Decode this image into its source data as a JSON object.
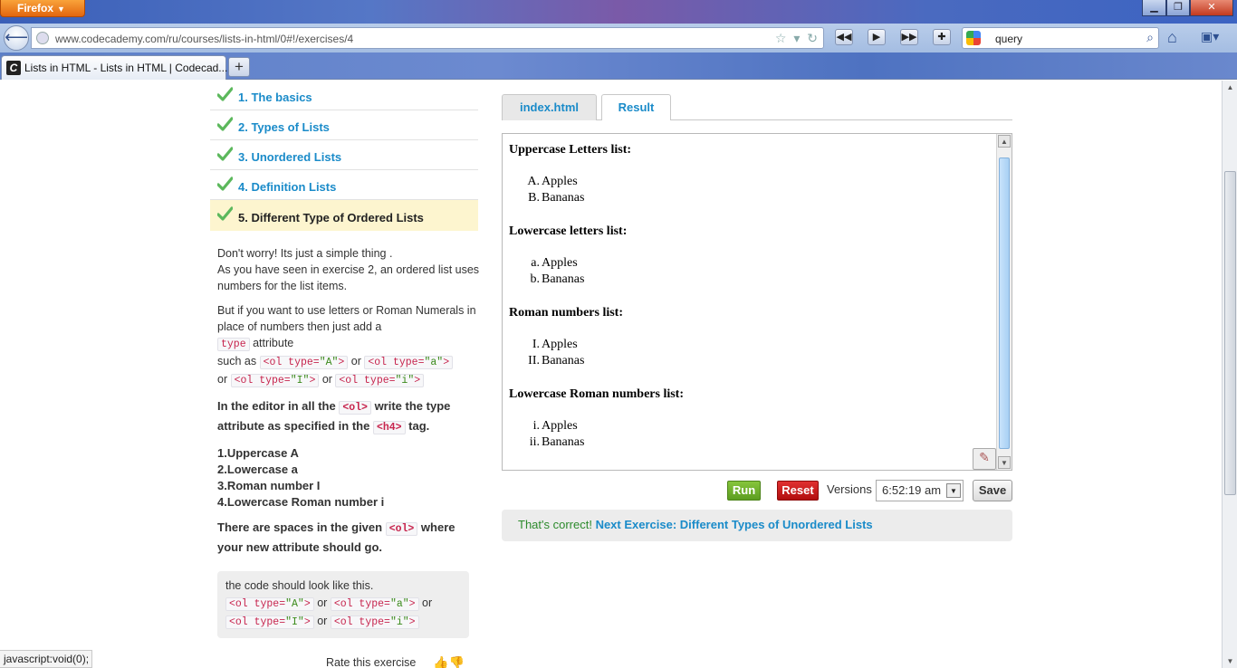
{
  "browser": {
    "app_button": "Firefox",
    "url": "www.codecademy.com/ru/courses/lists-in-html/0#!/exercises/4",
    "search_query": "query",
    "tab_title": "Lists in HTML - Lists in HTML | Codecad...",
    "status_text": "javascript:void(0);"
  },
  "exercises": [
    {
      "label": "1. The basics"
    },
    {
      "label": "2. Types of Lists"
    },
    {
      "label": "3. Unordered Lists"
    },
    {
      "label": "4. Definition Lists"
    },
    {
      "label": "5. Different Type of Ordered Lists"
    }
  ],
  "instructions": {
    "p1_line1": "Don't worry! Its just a simple thing .",
    "p1_line2": "As you have seen in exercise 2, an ordered list uses numbers for the list items.",
    "p2_text": "But if you want to use letters or Roman Numerals in place of numbers then just add a",
    "p2_code": "type",
    "p2_after": " attribute",
    "such_as": "such as ",
    "or": " or ",
    "code_A_open": "<ol type=",
    "code_A_val": "\"A\"",
    "code_a_val": "\"a\"",
    "code_I_val": "\"I\"",
    "code_i_val": "\"i\"",
    "code_close": ">",
    "p3_a": "In the editor in all the ",
    "p3_code1": "<ol>",
    "p3_b": " write the type attribute as specified in the ",
    "p3_code2": "<h4>",
    "p3_c": " tag.",
    "steps": [
      "1.Uppercase A",
      "2.Lowercase a",
      "3.Roman number I",
      "4.Lowercase Roman number i"
    ],
    "p4_a": "There are spaces in the given ",
    "p4_code": "<ol>",
    "p4_b": " where your new attribute should go."
  },
  "hint": {
    "text": "the code should look like this."
  },
  "rate_label": "Rate this exercise",
  "editor_tabs": {
    "file": "index.html",
    "result": "Result"
  },
  "result": {
    "sections": [
      {
        "heading": "Uppercase Letters list:",
        "markers": [
          "A.",
          "B."
        ],
        "items": [
          "Apples",
          "Bananas"
        ]
      },
      {
        "heading": "Lowercase letters list:",
        "markers": [
          "a.",
          "b."
        ],
        "items": [
          "Apples",
          "Bananas"
        ]
      },
      {
        "heading": "Roman numbers list:",
        "markers": [
          "I.",
          "II."
        ],
        "items": [
          "Apples",
          "Bananas"
        ]
      },
      {
        "heading": "Lowercase Roman numbers list:",
        "markers": [
          "i.",
          "ii."
        ],
        "items": [
          "Apples",
          "Bananas"
        ]
      }
    ]
  },
  "actions": {
    "run": "Run",
    "reset": "Reset",
    "versions_label": "Versions",
    "version_value": "6:52:19 am",
    "save": "Save"
  },
  "success": {
    "ok": "That's correct! ",
    "next": "Next Exercise: Different Types of Unordered Lists"
  },
  "colors": {
    "link": "#1a8bc9",
    "check": "#5cb85c",
    "current_bg": "#fdf5cf",
    "run": "#6aad2a",
    "reset": "#c41a1a"
  }
}
